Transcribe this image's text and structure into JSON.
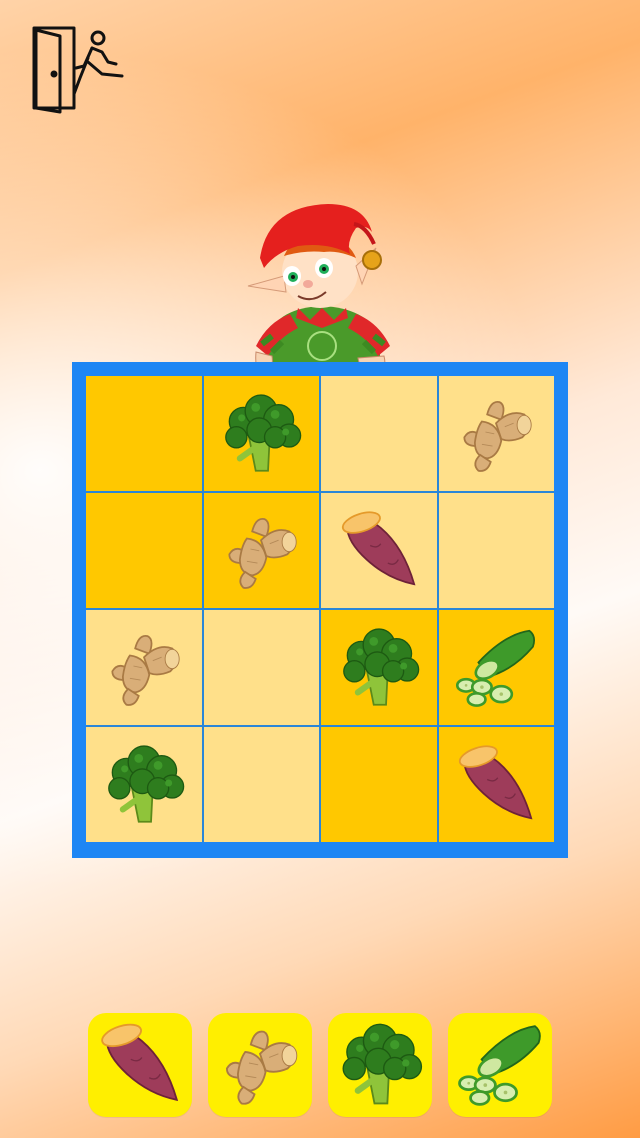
{
  "game": {
    "board": {
      "rows": [
        [
          "",
          "broccoli",
          "",
          "ginger"
        ],
        [
          "",
          "ginger",
          "sweet-potato",
          ""
        ],
        [
          "ginger",
          "",
          "broccoli",
          "cucumber"
        ],
        [
          "broccoli",
          "",
          "",
          "sweet-potato"
        ]
      ],
      "shading": [
        [
          "dark",
          "dark",
          "light",
          "light"
        ],
        [
          "dark",
          "dark",
          "light",
          "light"
        ],
        [
          "light",
          "light",
          "dark",
          "dark"
        ],
        [
          "light",
          "light",
          "dark",
          "dark"
        ]
      ]
    },
    "palette": [
      "sweet-potato",
      "ginger",
      "broccoli",
      "cucumber"
    ]
  },
  "icons": {
    "exit": "exit-door-icon",
    "mascot": "elf-mascot"
  },
  "colors": {
    "board_border": "#1e86f4",
    "cell_dark": "#ffc800",
    "cell_light": "#ffe08a",
    "palette_bg": "#ffef00"
  }
}
